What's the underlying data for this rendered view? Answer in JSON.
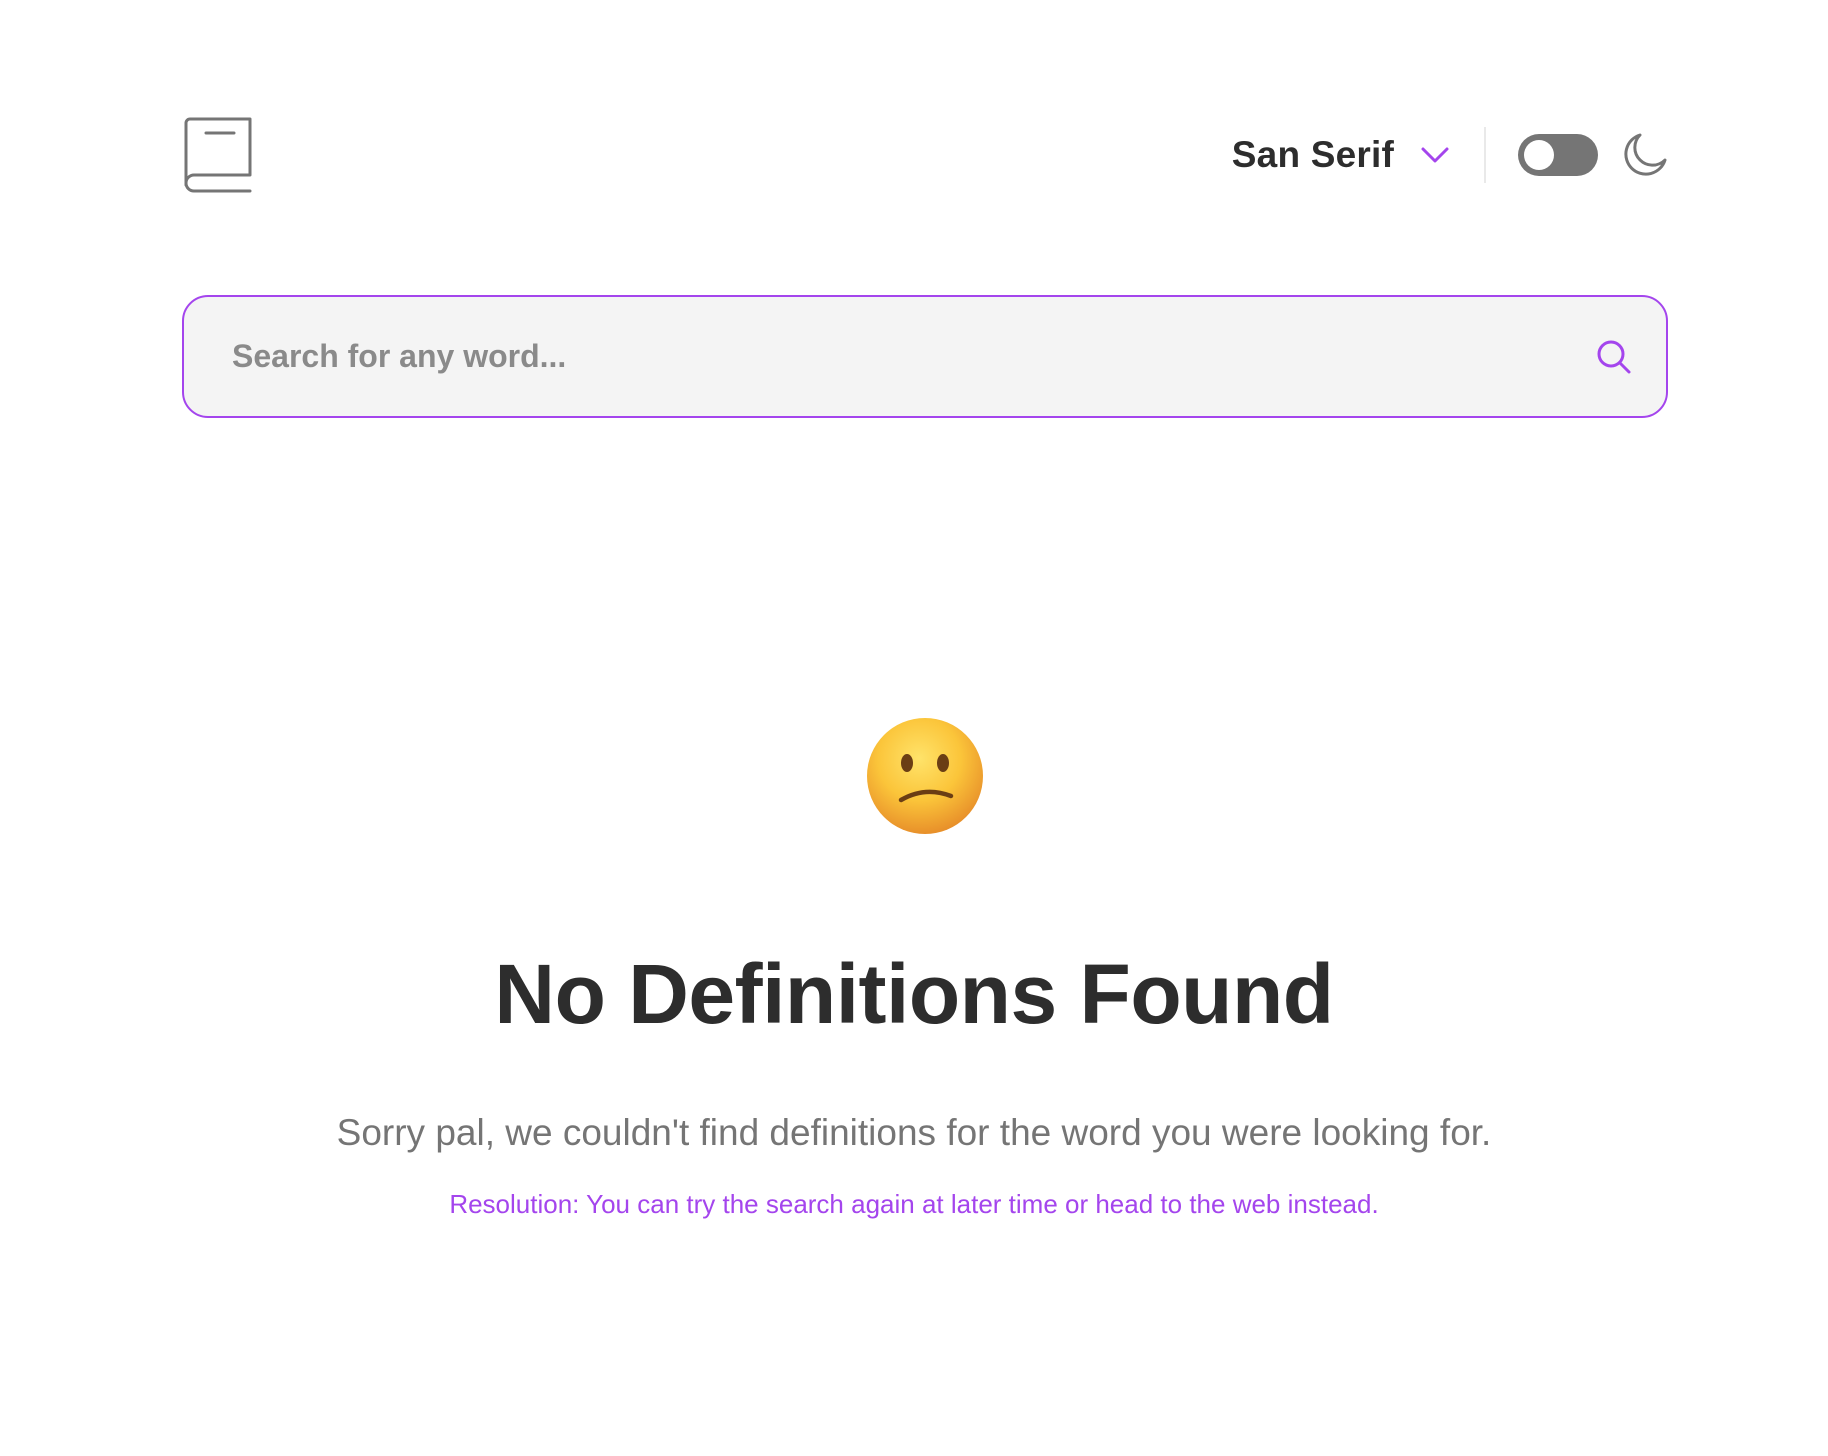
{
  "header": {
    "logo_icon": "book-icon",
    "font_selector": {
      "selected": "San Serif",
      "icon": "chevron-down-icon"
    },
    "theme_toggle": {
      "state": "off",
      "icon": "moon-icon"
    }
  },
  "search": {
    "placeholder": "Search for any word...",
    "value": "",
    "icon": "search-icon"
  },
  "empty_state": {
    "emoji": "confused-face",
    "title": "No Definitions Found",
    "message": "Sorry pal, we couldn't find definitions for the word you were looking for.",
    "resolution": "Resolution: You can try the search again at later time or head to the web instead."
  },
  "colors": {
    "accent": "#a445ed",
    "text_primary": "#2d2d2d",
    "text_secondary": "#757575",
    "search_bg": "#f4f4f4",
    "toggle_bg": "#757575"
  }
}
